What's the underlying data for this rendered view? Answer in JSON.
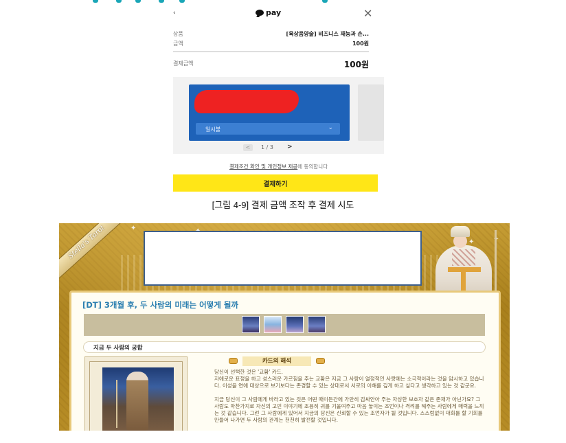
{
  "payment": {
    "back_label": "‹",
    "logo_label": "pay",
    "close_label": "✕",
    "product_key": "상품",
    "product_name": "[육상음양술] 비즈니스 재능과 손...",
    "amount_key": "금액",
    "amount_value": "100원",
    "total_key": "결제금액",
    "total_value": "100원",
    "card_plan": "일시불",
    "card_plan_chevron": "⌄",
    "pager_prev": "<",
    "pager_text": "1 / 3",
    "pager_next": ">",
    "terms_link": "결제조건 확인 및 개인정보 제공",
    "terms_rest": "에 동의합니다",
    "pay_button": "결제하기"
  },
  "caption": "[그림 4-9] 결제 금액 조작 후 결제 시도",
  "tarot": {
    "ribbon_text": "Stella's Tarot",
    "title": "[DT] 3개월 후, 두 사람의 미래는 어떻게 될까",
    "section_label": "지금 두 사람의 궁합",
    "interp_label": "카드의 해석",
    "paragraph1": "당신이 선택한 것은 '교황' 카드.\n자애로운 표정을 하고 성스러운 가르침을 주는 교황은 지금 그 사람이 열정적인 사랑에는 소극적이라는 것을 암시하고 있습니다. 이성을 연애 대상으로 보기보다는 존경할 수 있는 상대로서 서로의 이해를 깊게 하고 싶다고 생각하고 있는 것 같군요.",
    "paragraph2": "지금 당신이 그 사람에게 바라고 있는 것은 어떤 때이든간에 가만히 감싸안아 주는 자상한 보호자 같은 존재가 아닌가요? 그 사람도 마찬가지로 자신의 고민 이야기에 조용히 귀를 기울여주고 마음 놓이는 조언이나 격려를 해주는 사람에게 매력을 느끼는 것 같습니다. 그런 그 사람에게 있어서 지금의 당신은 신뢰할 수 있는 조언자가 될 것입니다. 스스럼없이 대화를 할 기회를 만들어 나가면 두 사람의 관계는 천천히 발전할 것입니다."
  },
  "colors": {
    "kakao_yellow": "#ffe617",
    "card_blue": "#1e62b8",
    "redaction_red": "#ee2222",
    "title_blue": "#2b7fb0",
    "tarot_gold": "#b3881f"
  }
}
